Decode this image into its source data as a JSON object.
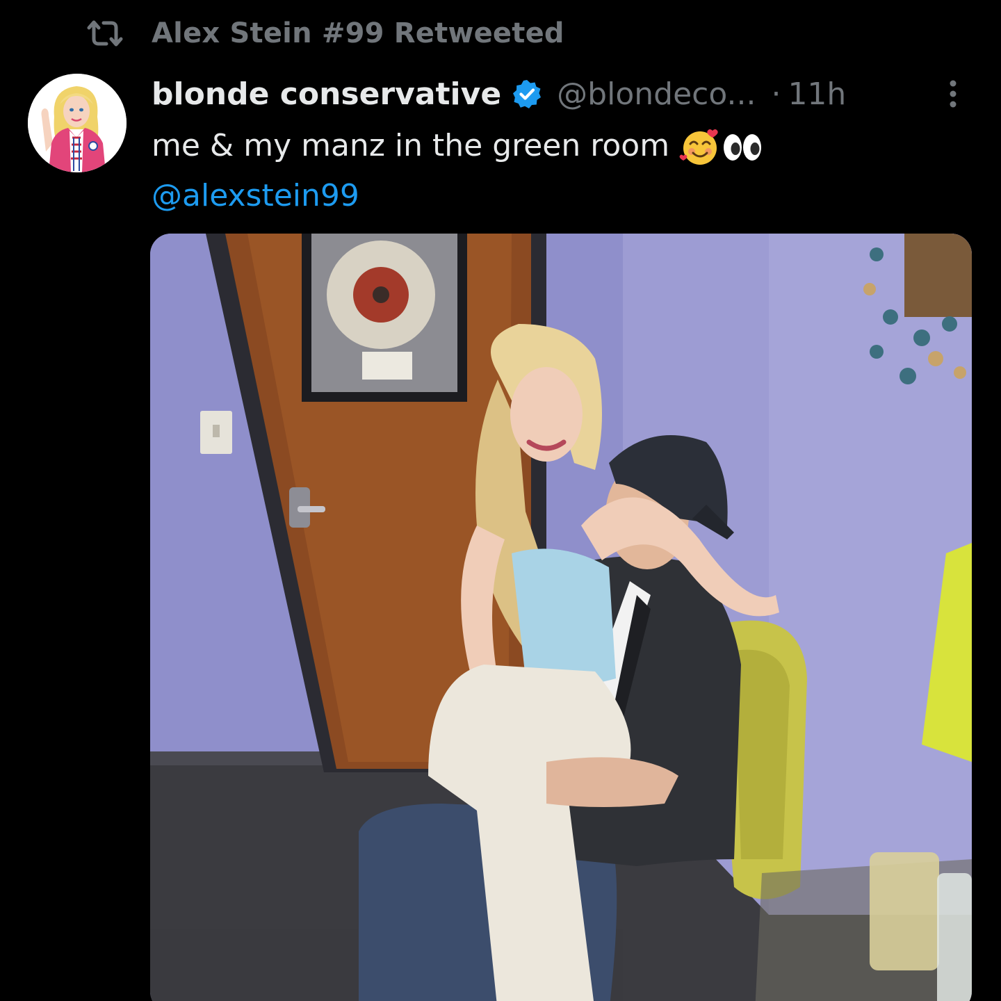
{
  "retweet": {
    "label": "Alex Stein #99 Retweeted"
  },
  "author": {
    "display_name": "blonde conservative",
    "handle": "@blondeco...",
    "separator": "·",
    "time": "11h",
    "verified": true
  },
  "post": {
    "text": "me & my manz in the green room",
    "mention": "@alexstein99"
  },
  "colors": {
    "background": "#000000",
    "primary_text": "#e7e9ea",
    "secondary_text": "#71767b",
    "accent": "#1d9bf0"
  },
  "icons": [
    "retweet-icon",
    "verified-badge-icon",
    "more-options-icon"
  ]
}
